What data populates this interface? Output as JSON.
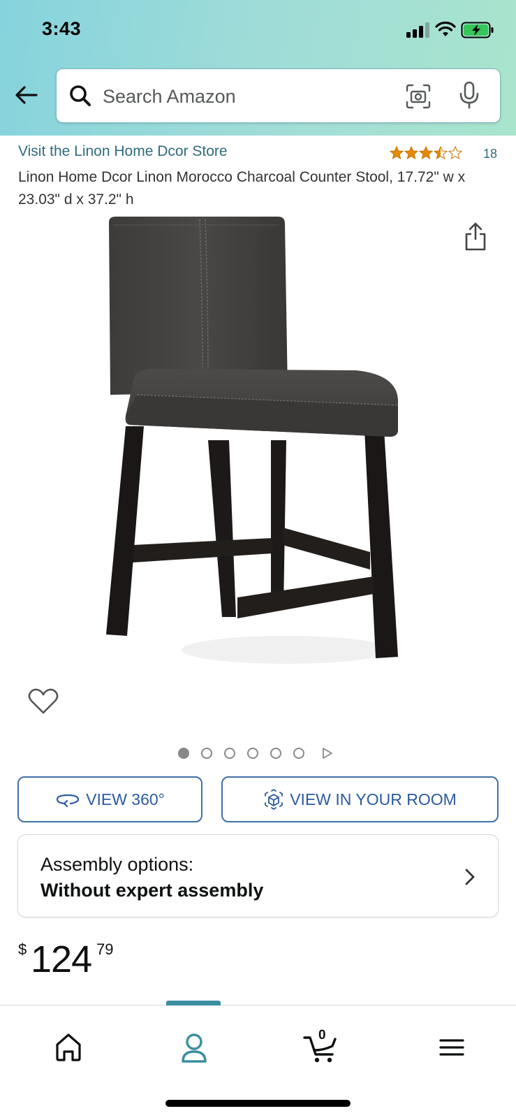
{
  "status_bar": {
    "time": "3:43"
  },
  "search": {
    "placeholder": "Search Amazon"
  },
  "product": {
    "store_link": "Visit the Linon Home Dcor Store",
    "rating_stars": 3.5,
    "rating_count": "18",
    "title": "Linon Home Dcor Linon Morocco Charcoal Counter Stool, 17.72\" w x 23.03\" d x 37.2\" h",
    "image_count": 6,
    "active_image_index": 0
  },
  "buttons": {
    "view_360": "VIEW 360°",
    "view_in_room": "VIEW IN YOUR ROOM"
  },
  "assembly": {
    "label": "Assembly options:",
    "value": "Without expert assembly"
  },
  "price": {
    "symbol": "$",
    "whole": "124",
    "fraction": "79"
  },
  "cart": {
    "count": "0"
  },
  "colors": {
    "header_gradient_start": "#86d3dd",
    "header_gradient_end": "#a9e4cd",
    "link": "#2f6b7b",
    "button_accent": "#2c5aa0",
    "star": "#e68a00",
    "nav_active": "#3a8fa0"
  },
  "icons": {
    "back": "back-arrow-icon",
    "search": "search-icon",
    "camera": "camera-scan-icon",
    "mic": "microphone-icon",
    "share": "share-icon",
    "wishlist": "heart-icon",
    "rotate": "rotate-360-icon",
    "ar": "ar-cube-icon",
    "chevron": "chevron-right-icon",
    "home": "home-icon",
    "account": "person-icon",
    "cart": "cart-icon",
    "menu": "hamburger-menu-icon"
  }
}
